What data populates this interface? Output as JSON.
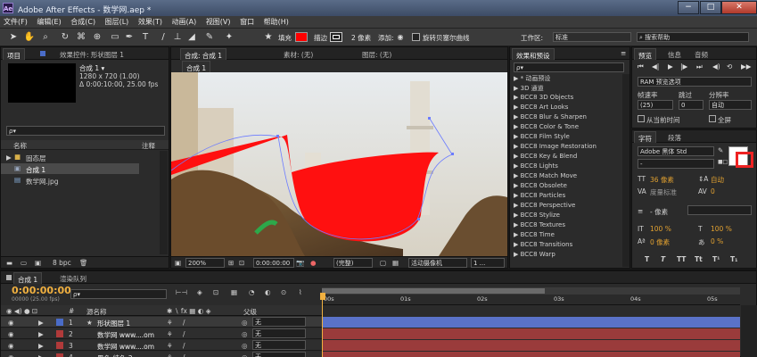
{
  "titlebar": {
    "title": "Adobe After Effects - 数学网.aep *",
    "logo": "Ae",
    "minimize": "−",
    "maximize": "□",
    "close": "✕"
  },
  "menu": [
    "文件(F)",
    "编辑(E)",
    "合成(C)",
    "图层(L)",
    "效果(T)",
    "动画(A)",
    "视图(V)",
    "窗口",
    "帮助(H)"
  ],
  "toolbar": {
    "fill_label": "填充",
    "stroke_label": "描边",
    "stroke_width": "2 像素",
    "add_label": "添加:",
    "bezier_label": "旋转贝塞尔曲线",
    "workspace_label": "工作区:",
    "workspace_value": "标准",
    "search_placeholder": "搜索帮助",
    "colors": {
      "fill": "#ff0000",
      "stroke": "#ffffff"
    }
  },
  "project": {
    "tabs": [
      "项目",
      "效果控件: 形状图层 1"
    ],
    "comp_name": "合成 1 ▾",
    "comp_size": "1280 x 720 (1.00)",
    "comp_duration": "Δ 0:00:10:00, 25.00 fps",
    "search_placeholder": "ρ▾",
    "col_name": "名称",
    "col_comment": "注释",
    "items": [
      {
        "name": "固态层",
        "type": "folder"
      },
      {
        "name": "合成 1",
        "type": "comp"
      },
      {
        "name": "数学网.jpg",
        "type": "image"
      }
    ],
    "bpc": "8 bpc"
  },
  "viewer": {
    "tabs": [
      "合成: 合成 1",
      "素材: (无)",
      "图层: (无)"
    ],
    "comp_tab_label": "合成 1",
    "zoom": "200%",
    "timecode": "0:00:00:00",
    "resolution": "(完整)",
    "camera": "活动摄像机",
    "views": "1 ..."
  },
  "effects": {
    "title": "效果和预设",
    "search_placeholder": "ρ▾",
    "items": [
      "* 动画预设",
      "3D 通道",
      "BCC8 3D Objects",
      "BCC8 Art Looks",
      "BCC8 Blur & Sharpen",
      "BCC8 Color & Tone",
      "BCC8 Film Style",
      "BCC8 Image Restoration",
      "BCC8 Key & Blend",
      "BCC8 Lights",
      "BCC8 Match Move",
      "BCC8 Obsolete",
      "BCC8 Particles",
      "BCC8 Perspective",
      "BCC8 Stylize",
      "BCC8 Textures",
      "BCC8 Time",
      "BCC8 Transitions",
      "BCC8 Warp"
    ]
  },
  "preview": {
    "tabs": [
      "预览",
      "信息",
      "音频"
    ],
    "ram_label": "RAM 预览选项",
    "framerate_label": "帧速率",
    "skip_label": "跳过",
    "resolution_label": "分辨率",
    "framerate_value": "(25)",
    "skip_value": "0",
    "resolution_value": "自动",
    "from_current": "从当前时间",
    "fullscreen": "全屏"
  },
  "character": {
    "tabs": [
      "字符",
      "段落"
    ],
    "font": "Adobe 黑体 Std",
    "style": "-",
    "size": "36 像素",
    "leading": "自动",
    "tracking_metric": "度量标准",
    "tracking": "0",
    "stroke": "- 像素",
    "vscale": "100 %",
    "hscale": "100 %",
    "baseline": "0 像素",
    "tsume": "0 %",
    "styles": [
      "T",
      "T",
      "TT",
      "Tt",
      "T¹",
      "T₁"
    ]
  },
  "timeline": {
    "tabs": [
      "合成 1",
      "渲染队列"
    ],
    "timecode": "0:00:00:00",
    "timecode_sub": "00000 (25.00 fps)",
    "search_placeholder": "ρ▾",
    "columns": {
      "num": "#",
      "name": "源名称",
      "parent": "父级"
    },
    "ruler": [
      "00s",
      "01s",
      "02s",
      "03s",
      "04s",
      "05s"
    ],
    "layers": [
      {
        "num": "1",
        "name": "形状图层 1",
        "star": "★",
        "color": "#4a6cc8",
        "parent": "无",
        "bar_color": "#5a72c8"
      },
      {
        "num": "2",
        "name": "数学网 www....om",
        "star": "",
        "color": "#b03a3a",
        "parent": "无",
        "bar_color": "#9a3b3b"
      },
      {
        "num": "3",
        "name": "数学网 www....om",
        "star": "",
        "color": "#b03a3a",
        "parent": "无",
        "bar_color": "#9a3b3b"
      },
      {
        "num": "4",
        "name": "黑色 纯色 3",
        "star": "",
        "color": "#b03a3a",
        "parent": "无",
        "bar_color": "#9a3b3b"
      }
    ]
  }
}
